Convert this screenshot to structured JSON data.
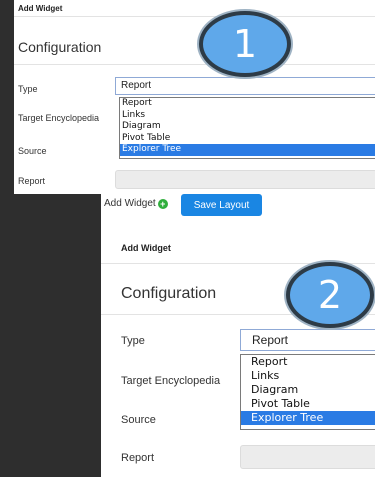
{
  "panel1": {
    "title": "Add Widget",
    "section": "Configuration",
    "labels": {
      "type": "Type",
      "target": "Target Encyclopedia",
      "source": "Source",
      "report": "Report"
    },
    "type_select": {
      "value": "Report"
    },
    "options": [
      "Report",
      "Links",
      "Diagram",
      "Pivot Table",
      "Explorer Tree"
    ],
    "selected_option": "Explorer Tree",
    "badge": "1"
  },
  "toolbar": {
    "add_widget_label": "Add Widget",
    "add_icon": "plus-circle-icon",
    "save_layout_label": "Save Layout"
  },
  "panel2": {
    "title": "Add Widget",
    "section": "Configuration",
    "labels": {
      "type": "Type",
      "target": "Target Encyclopedia",
      "source": "Source",
      "report": "Report"
    },
    "type_select": {
      "value": "Report"
    },
    "options": [
      "Report",
      "Links",
      "Diagram",
      "Pivot Table",
      "Explorer Tree"
    ],
    "selected_option": "Explorer Tree",
    "badge": "2"
  },
  "colors": {
    "background": "#2e2e2e",
    "accent_blue": "#1a86e3",
    "selected_option": "#2a7be4",
    "badge": "#5fa8ea",
    "add_icon": "#2fae3c"
  }
}
